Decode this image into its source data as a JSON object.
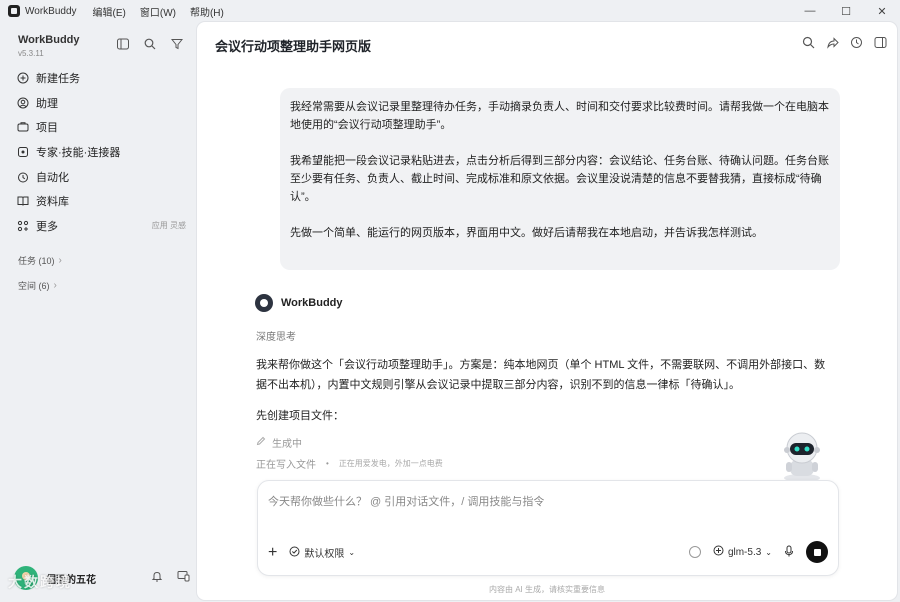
{
  "window": {
    "app_name": "WorkBuddy",
    "menu": [
      "编辑(E)",
      "窗口(W)",
      "帮助(H)"
    ],
    "controls": [
      "—",
      "☐",
      "✕"
    ]
  },
  "sidebar": {
    "brand": "WorkBuddy",
    "version": "v5.3.11",
    "items": [
      {
        "label": "新建任务",
        "icon": "plus-circle-icon"
      },
      {
        "label": "助理",
        "icon": "assistant-icon"
      },
      {
        "label": "项目",
        "icon": "project-icon"
      },
      {
        "label": "专家·技能·连接器",
        "icon": "expert-icon"
      },
      {
        "label": "自动化",
        "icon": "clock-icon"
      },
      {
        "label": "资料库",
        "icon": "book-icon"
      },
      {
        "label": "更多",
        "icon": "grid-icon",
        "extra": "应用 灵感"
      }
    ],
    "sections": [
      {
        "label": "任务 (10)"
      },
      {
        "label": "空间 (6)"
      }
    ],
    "user": {
      "name": "倔强的五花"
    },
    "watermark": "大数跨境"
  },
  "main": {
    "title": "会议行动项整理助手网页版",
    "user_message": [
      "我经常需要从会议记录里整理待办任务，手动摘录负责人、时间和交付要求比较费时间。请帮我做一个在电脑本地使用的“会议行动项整理助手”。",
      "我希望能把一段会议记录粘贴进去，点击分析后得到三部分内容：会议结论、任务台账、待确认问题。任务台账至少要有任务、负责人、截止时间、完成标准和原文依据。会议里没说清楚的信息不要替我猜，直接标成“待确认”。",
      "先做一个简单、能运行的网页版本，界面用中文。做好后请帮我在本地启动，并告诉我怎样测试。"
    ],
    "bot": {
      "name": "WorkBuddy",
      "thinking": "深度思考",
      "reply": "我来帮你做这个「会议行动项整理助手」。方案是：纯本地网页（单个 HTML 文件，不需要联网、不调用外部接口、数据不出本机），内置中文规则引擎从会议记录中提取三部分内容，识别不到的信息一律标「待确认」。",
      "reply2": "先创建项目文件：",
      "generating": "生成中",
      "writing": "正在写入文件",
      "hint": "正在用爱发电，外加一点电费"
    },
    "composer": {
      "placeholder": "今天帮你做些什么？ @ 引用对话文件，/ 调用技能与指令",
      "permission": "默认权限",
      "model": "glm-5.3"
    },
    "disclaimer": "内容由 AI 生成，请核实重要信息"
  }
}
